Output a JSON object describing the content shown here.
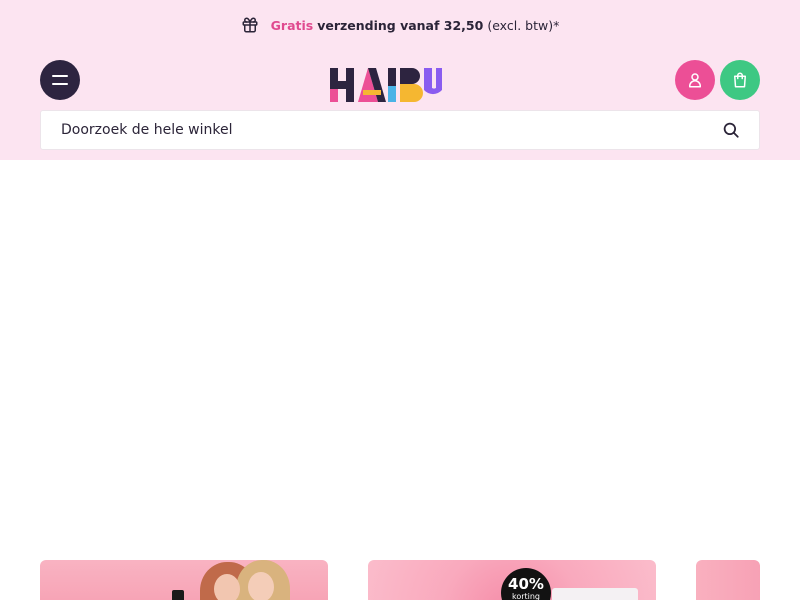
{
  "promo": {
    "highlight": "Gratis",
    "strong": "verzending vanaf 32,50",
    "normal": "(excl. btw)*"
  },
  "header": {
    "logo_text": "HAIBU"
  },
  "search": {
    "placeholder": "Doorzoek de hele winkel"
  },
  "banners": [
    {
      "name": "banner-models"
    },
    {
      "name": "banner-discount",
      "badge_percent": "40%",
      "badge_label": "korting"
    },
    {
      "name": "banner-partial"
    }
  ],
  "colors": {
    "header_bg": "#fce4f1",
    "accent_pink": "#e0498f",
    "menu_dark": "#2d2440",
    "account_pink": "#ec4f96",
    "cart_green": "#3ec883"
  }
}
